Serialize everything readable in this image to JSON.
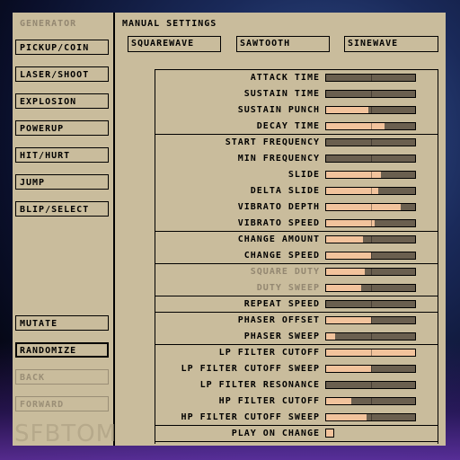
{
  "generator": {
    "heading": "GENERATOR",
    "buttons": [
      "PICKUP/COIN",
      "LASER/SHOOT",
      "EXPLOSION",
      "POWERUP",
      "HIT/HURT",
      "JUMP",
      "BLIP/SELECT"
    ],
    "mutate": "MUTATE",
    "randomize": "RANDOMIZE",
    "back": "BACK",
    "forward": "FORWARD",
    "logo": "SFBTOM"
  },
  "manual": {
    "heading": "MANUAL SETTINGS",
    "waveforms": [
      "SQUAREWAVE",
      "SAWTOOTH",
      "SINEWAVE"
    ]
  },
  "params": [
    {
      "label": "ATTACK TIME",
      "value": 0.0,
      "disabled": false
    },
    {
      "label": "SUSTAIN TIME",
      "value": 0.0,
      "disabled": false
    },
    {
      "label": "SUSTAIN PUNCH",
      "value": 0.47,
      "disabled": false
    },
    {
      "label": "DECAY TIME",
      "value": 0.66,
      "disabled": false
    },
    {
      "label": "START FREQUENCY",
      "value": 0.0,
      "disabled": false
    },
    {
      "label": "MIN FREQUENCY",
      "value": 0.0,
      "disabled": false
    },
    {
      "label": "SLIDE",
      "value": 0.62,
      "disabled": false
    },
    {
      "label": "DELTA SLIDE",
      "value": 0.59,
      "disabled": false
    },
    {
      "label": "VIBRATO DEPTH",
      "value": 0.84,
      "disabled": false
    },
    {
      "label": "VIBRATO SPEED",
      "value": 0.55,
      "disabled": false
    },
    {
      "label": "CHANGE AMOUNT",
      "value": 0.41,
      "disabled": false
    },
    {
      "label": "CHANGE SPEED",
      "value": 0.5,
      "disabled": false
    },
    {
      "label": "SQUARE DUTY",
      "value": 0.43,
      "disabled": true
    },
    {
      "label": "DUTY SWEEP",
      "value": 0.39,
      "disabled": true
    },
    {
      "label": "REPEAT SPEED",
      "value": 0.0,
      "disabled": false
    },
    {
      "label": "PHASER OFFSET",
      "value": 0.51,
      "disabled": false
    },
    {
      "label": "PHASER SWEEP",
      "value": 0.1,
      "disabled": false
    },
    {
      "label": "LP FILTER CUTOFF",
      "value": 1.0,
      "disabled": false
    },
    {
      "label": "LP FILTER CUTOFF SWEEP",
      "value": 0.5,
      "disabled": false
    },
    {
      "label": "LP FILTER RESONANCE",
      "value": 0.0,
      "disabled": false
    },
    {
      "label": "HP FILTER CUTOFF",
      "value": 0.28,
      "disabled": false
    },
    {
      "label": "HP FILTER CUTOFF SWEEP",
      "value": 0.45,
      "disabled": false
    }
  ],
  "play_on_change": {
    "label": "PLAY ON CHANGE",
    "checked": false
  },
  "colors": {
    "panel": "#c9bc9c",
    "slider_track": "#6a5f4f",
    "slider_fill": "#f2c39c",
    "disabled_text": "#938771"
  }
}
